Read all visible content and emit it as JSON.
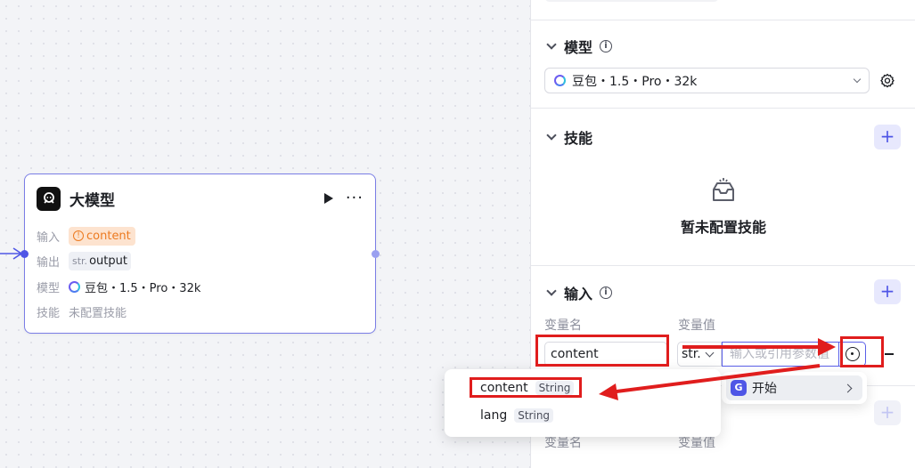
{
  "node": {
    "title": "大模型",
    "input_label": "输入",
    "input_value": "content",
    "output_label": "输出",
    "output_type": "str.",
    "output_value": "output",
    "model_label": "模型",
    "model_value": "豆包・1.5・Pro・32k",
    "skill_label": "技能",
    "skill_value": "未配置技能"
  },
  "panel": {
    "model_section": {
      "title": "模型",
      "selected_model": "豆包・1.5・Pro・32k"
    },
    "skill_section": {
      "title": "技能",
      "empty_text": "暂未配置技能"
    },
    "input_section": {
      "title": "输入",
      "col_name": "变量名",
      "col_value": "变量值",
      "row": {
        "name": "content",
        "type": "str.",
        "value_placeholder": "输入或引用参数值"
      }
    },
    "output_section": {
      "col_name": "变量名",
      "col_value": "变量值"
    }
  },
  "start_menu": {
    "label": "开始"
  },
  "variable_menu": {
    "items": [
      {
        "name": "content",
        "type": "String"
      },
      {
        "name": "lang",
        "type": "String"
      }
    ]
  },
  "colors": {
    "accent": "#4f56e6",
    "highlight": "#e01d1d",
    "warning": "#ec7a20"
  }
}
